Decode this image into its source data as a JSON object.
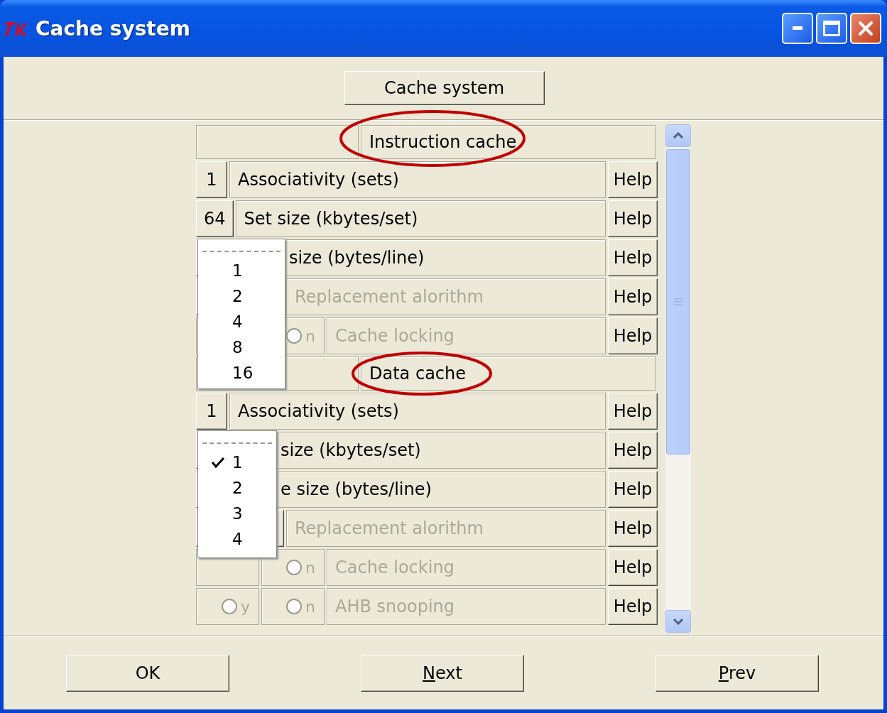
{
  "window": {
    "title": "Cache system"
  },
  "top_button": {
    "label": "Cache system"
  },
  "sections": [
    {
      "title": "Instruction cache",
      "highlighted": true,
      "rows": [
        {
          "kind": "number",
          "value": "1",
          "label": "Associativity (sets)",
          "disabled": false,
          "help": "Help"
        },
        {
          "kind": "number",
          "value": "64",
          "label": "Set size (kbytes/set)",
          "disabled": false,
          "help": "Help"
        },
        {
          "kind": "number",
          "label": "size (bytes/line)",
          "disabled": false,
          "help": "Help"
        },
        {
          "kind": "choice",
          "label": "Replacement alorithm",
          "disabled": true,
          "help": "Help"
        },
        {
          "kind": "radio",
          "no_option": {
            "label": "n",
            "selected": false
          },
          "label": "Cache locking",
          "disabled": true,
          "help": "Help"
        }
      ],
      "menu": {
        "items": [
          {
            "label": "1",
            "checked": false
          },
          {
            "label": "2",
            "checked": false
          },
          {
            "label": "4",
            "checked": false
          },
          {
            "label": "8",
            "checked": false
          },
          {
            "label": "16",
            "checked": false
          }
        ]
      }
    },
    {
      "title": "Data cache",
      "highlighted": true,
      "rows": [
        {
          "kind": "number",
          "value": "1",
          "label": "Associativity (sets)",
          "disabled": false,
          "help": "Help"
        },
        {
          "kind": "number",
          "label": "size (kbytes/set)",
          "disabled": false,
          "help": "Help"
        },
        {
          "kind": "number",
          "label": "e size (bytes/line)",
          "disabled": false,
          "help": "Help"
        },
        {
          "kind": "choice",
          "label": "Replacement alorithm",
          "disabled": true,
          "help": "Help"
        },
        {
          "kind": "radio",
          "no_option": {
            "label": "n",
            "selected": false
          },
          "label": "Cache locking",
          "disabled": true,
          "help": "Help"
        },
        {
          "kind": "radio",
          "yes_option": {
            "label": "y",
            "selected": false
          },
          "no_option": {
            "label": "n",
            "selected": false
          },
          "label": "AHB snooping",
          "disabled": true,
          "help": "Help"
        }
      ],
      "menu": {
        "items": [
          {
            "label": "1",
            "checked": true
          },
          {
            "label": "2",
            "checked": false
          },
          {
            "label": "3",
            "checked": false
          },
          {
            "label": "4",
            "checked": false
          }
        ]
      }
    }
  ],
  "buttons": [
    {
      "label": "OK",
      "underline_first": false
    },
    {
      "label": "Next",
      "underline_first": true
    },
    {
      "label": "Prev",
      "underline_first": true
    }
  ]
}
